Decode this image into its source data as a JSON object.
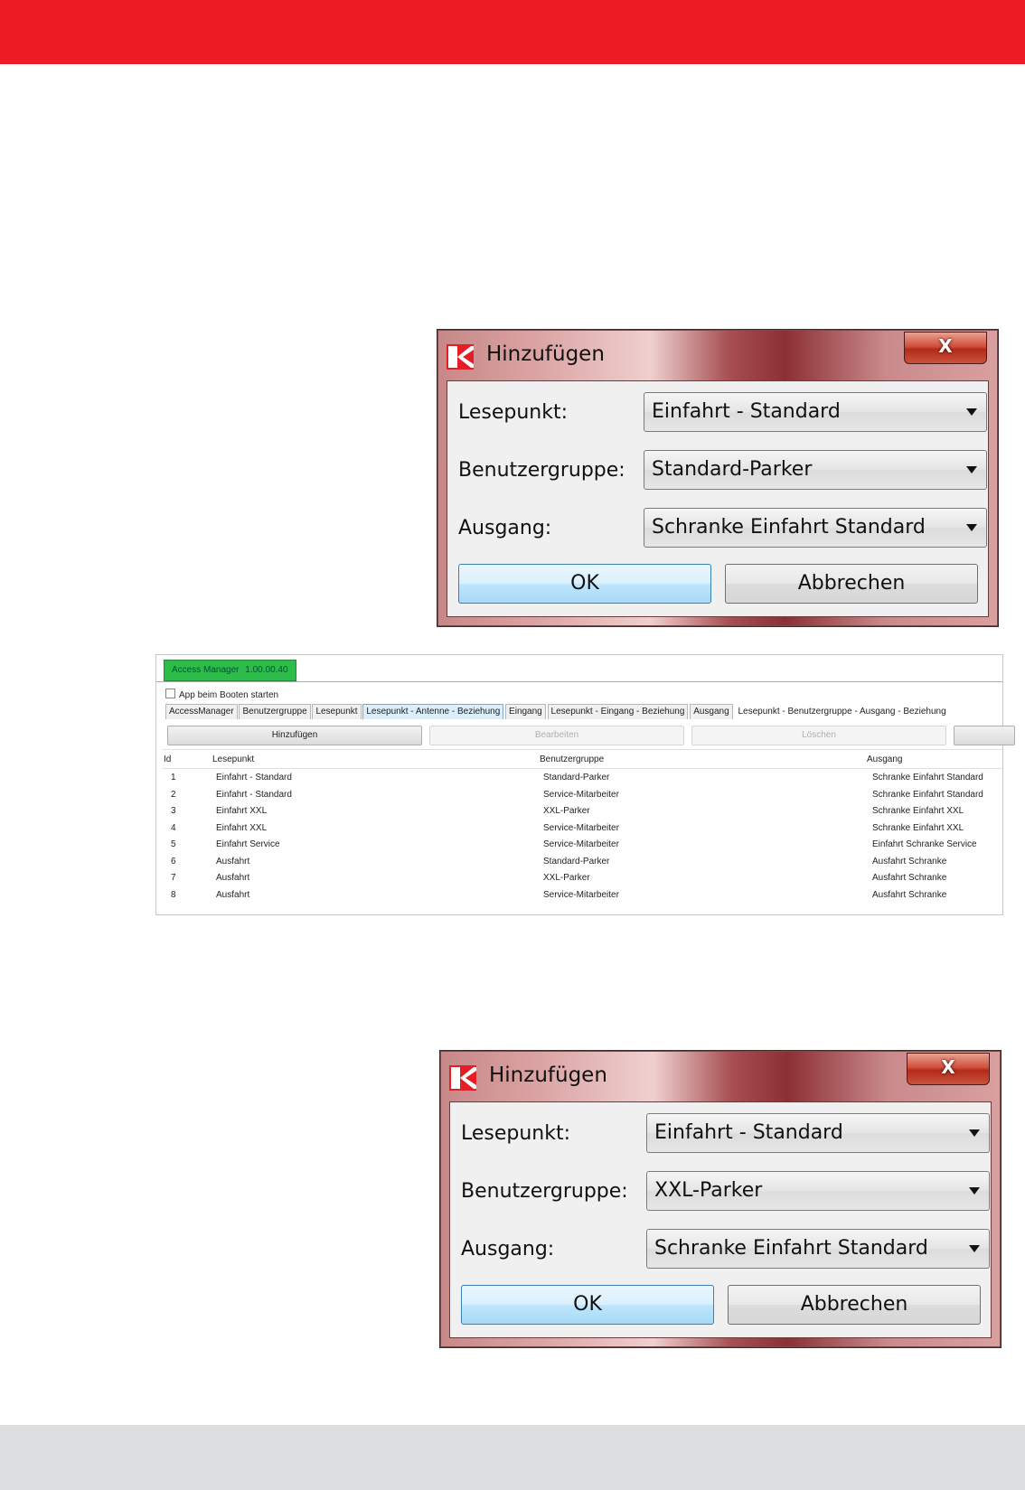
{
  "colors": {
    "header_bar": "#ed1c24",
    "footer_bar": "#dcdddf",
    "app_tab": "#2dbb4a"
  },
  "dialog_top": {
    "title": "Hinzufügen",
    "close": "X",
    "lesepunkt_label": "Lesepunkt:",
    "lesepunkt_value": "Einfahrt - Standard",
    "benutzergruppe_label": "Benutzergruppe:",
    "benutzergruppe_value": "Standard-Parker",
    "ausgang_label": "Ausgang:",
    "ausgang_value": "Schranke Einfahrt Standard",
    "ok": "OK",
    "cancel": "Abbrechen"
  },
  "app": {
    "tab_title": "Access Manager",
    "version": "1.00.00.40",
    "boot_checkbox_label": "App beim Booten starten",
    "tabs": [
      "AccessManager",
      "Benutzergruppe",
      "Lesepunkt",
      "Lesepunkt - Antenne - Beziehung",
      "Eingang",
      "Lesepunkt - Eingang - Beziehung",
      "Ausgang",
      "Lesepunkt - Benutzergruppe - Ausgang - Beziehung"
    ],
    "buttons": {
      "add": "Hinzufügen",
      "edit": "Bearbeiten",
      "delete": "Löschen"
    },
    "columns": {
      "id": "Id",
      "lesepunkt": "Lesepunkt",
      "benutzergruppe": "Benutzergruppe",
      "ausgang": "Ausgang"
    },
    "rows": [
      {
        "id": "1",
        "lesepunkt": "Einfahrt - Standard",
        "benutzergruppe": "Standard-Parker",
        "ausgang": "Schranke Einfahrt Standard"
      },
      {
        "id": "2",
        "lesepunkt": "Einfahrt - Standard",
        "benutzergruppe": "Service-Mitarbeiter",
        "ausgang": "Schranke Einfahrt Standard"
      },
      {
        "id": "3",
        "lesepunkt": "Einfahrt XXL",
        "benutzergruppe": "XXL-Parker",
        "ausgang": "Schranke Einfahrt XXL"
      },
      {
        "id": "4",
        "lesepunkt": "Einfahrt XXL",
        "benutzergruppe": "Service-Mitarbeiter",
        "ausgang": "Schranke Einfahrt XXL"
      },
      {
        "id": "5",
        "lesepunkt": "Einfahrt Service",
        "benutzergruppe": "Service-Mitarbeiter",
        "ausgang": "Einfahrt Schranke Service"
      },
      {
        "id": "6",
        "lesepunkt": "Ausfahrt",
        "benutzergruppe": "Standard-Parker",
        "ausgang": "Ausfahrt Schranke"
      },
      {
        "id": "7",
        "lesepunkt": "Ausfahrt",
        "benutzergruppe": "XXL-Parker",
        "ausgang": "Ausfahrt Schranke"
      },
      {
        "id": "8",
        "lesepunkt": "Ausfahrt",
        "benutzergruppe": "Service-Mitarbeiter",
        "ausgang": "Ausfahrt Schranke"
      }
    ]
  },
  "dialog_bottom": {
    "title": "Hinzufügen",
    "close": "X",
    "lesepunkt_label": "Lesepunkt:",
    "lesepunkt_value": "Einfahrt - Standard",
    "benutzergruppe_label": "Benutzergruppe:",
    "benutzergruppe_value": "XXL-Parker",
    "ausgang_label": "Ausgang:",
    "ausgang_value": "Schranke Einfahrt Standard",
    "ok": "OK",
    "cancel": "Abbrechen"
  }
}
